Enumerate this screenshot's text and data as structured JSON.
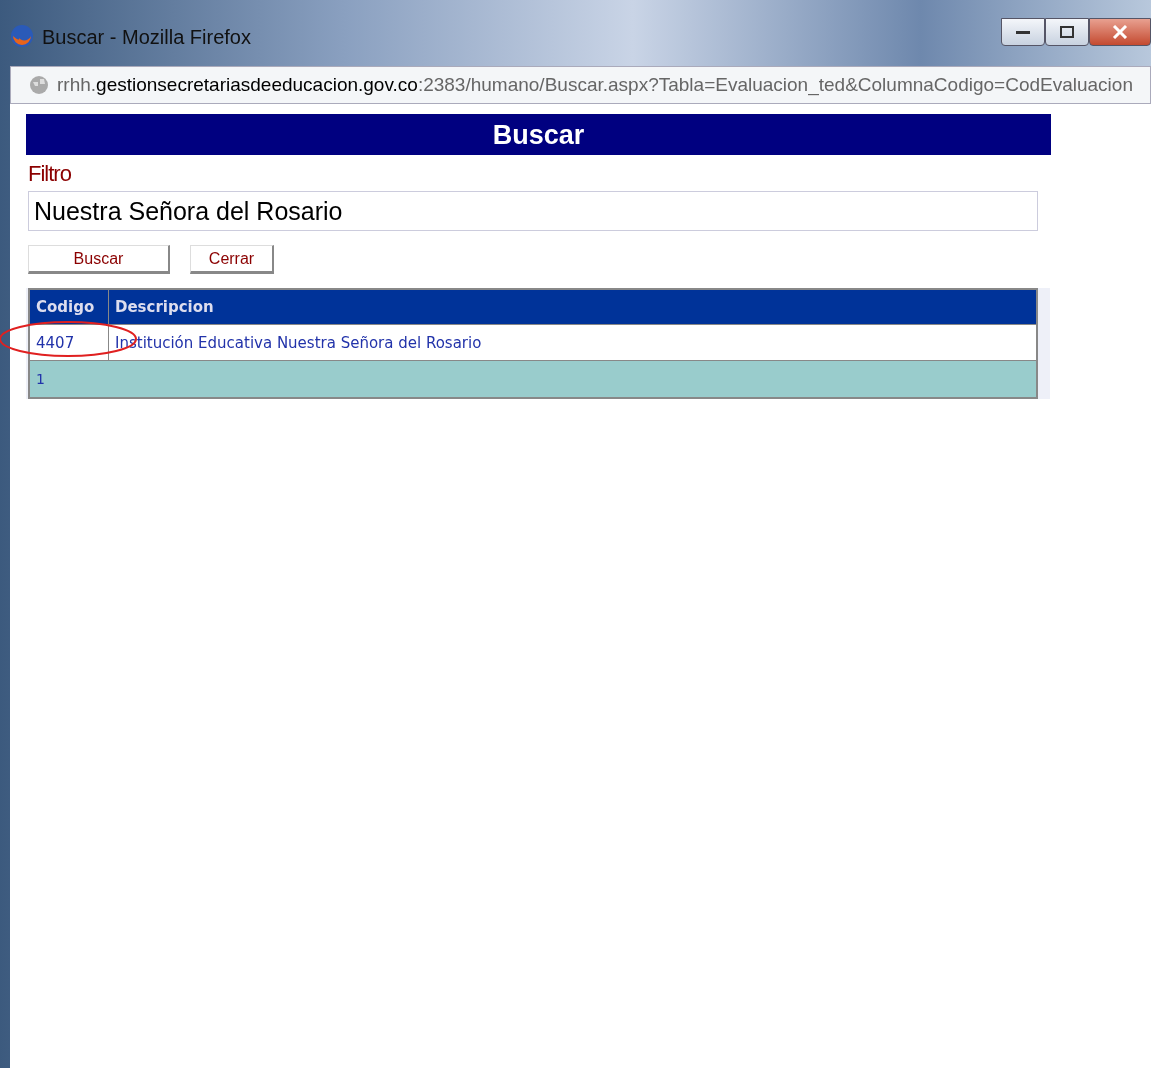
{
  "window": {
    "title": "Buscar - Mozilla Firefox",
    "controls": [
      {
        "kind": "minimize"
      },
      {
        "kind": "maximize"
      },
      {
        "kind": "close"
      }
    ]
  },
  "address_bar": {
    "url": "rrhh.**gestionsecretariasdeeducacion.gov.co**:2383/humano/Buscar.aspx?Tabla=Evaluacion_ted&ColumnaCodigo=CodEvaluacion"
  },
  "page": {
    "heading": "Buscar",
    "filter_label": "Filtro",
    "filter_value": "Nuestra Señora del Rosario",
    "buttons": [
      "Buscar",
      "Cerrar"
    ]
  },
  "table": {
    "columns": [
      "Codigo",
      "Descripcion"
    ],
    "rows": [
      {
        "cells": [
          "4407",
          "Institución Educativa Nuestra Señora del Rosario"
        ],
        "highlighted": true
      }
    ],
    "pager": [
      "1"
    ]
  }
}
